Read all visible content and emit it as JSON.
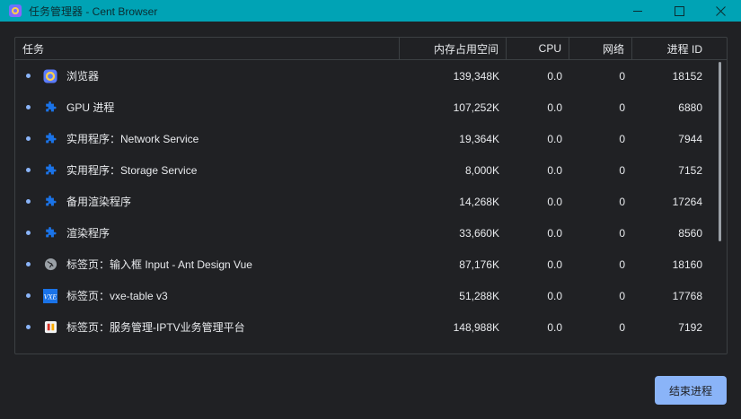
{
  "window": {
    "title": "任务管理器 - Cent Browser"
  },
  "colors": {
    "titlebar": "#00a3b5",
    "accent": "#8ab4f8",
    "background": "#202124"
  },
  "table": {
    "headers": {
      "task": "任务",
      "memory": "内存占用空间",
      "cpu": "CPU",
      "network": "网络",
      "pid": "进程 ID"
    },
    "rows": [
      {
        "icon": "browser-icon",
        "task": "浏览器",
        "memory": "139,348K",
        "cpu": "0.0",
        "network": "0",
        "pid": "18152"
      },
      {
        "icon": "puzzle-icon",
        "task": "GPU 进程",
        "memory": "107,252K",
        "cpu": "0.0",
        "network": "0",
        "pid": "6880"
      },
      {
        "icon": "puzzle-icon",
        "task": "实用程序：Network Service",
        "memory": "19,364K",
        "cpu": "0.0",
        "network": "0",
        "pid": "7944"
      },
      {
        "icon": "puzzle-icon",
        "task": "实用程序：Storage Service",
        "memory": "8,000K",
        "cpu": "0.0",
        "network": "0",
        "pid": "7152"
      },
      {
        "icon": "puzzle-icon",
        "task": "备用渲染程序",
        "memory": "14,268K",
        "cpu": "0.0",
        "network": "0",
        "pid": "17264"
      },
      {
        "icon": "puzzle-icon",
        "task": "渲染程序",
        "memory": "33,660K",
        "cpu": "0.0",
        "network": "0",
        "pid": "8560"
      },
      {
        "icon": "globe-icon",
        "task": "标签页：输入框 Input - Ant Design Vue",
        "memory": "87,176K",
        "cpu": "0.0",
        "network": "0",
        "pid": "18160"
      },
      {
        "icon": "vxe-icon",
        "task": "标签页：vxe-table v3",
        "memory": "51,288K",
        "cpu": "0.0",
        "network": "0",
        "pid": "17768"
      },
      {
        "icon": "favicon-icon",
        "task": "标签页：服务管理-IPTV业务管理平台",
        "memory": "148,988K",
        "cpu": "0.0",
        "network": "0",
        "pid": "7192"
      }
    ]
  },
  "actions": {
    "end_process": "结束进程"
  }
}
